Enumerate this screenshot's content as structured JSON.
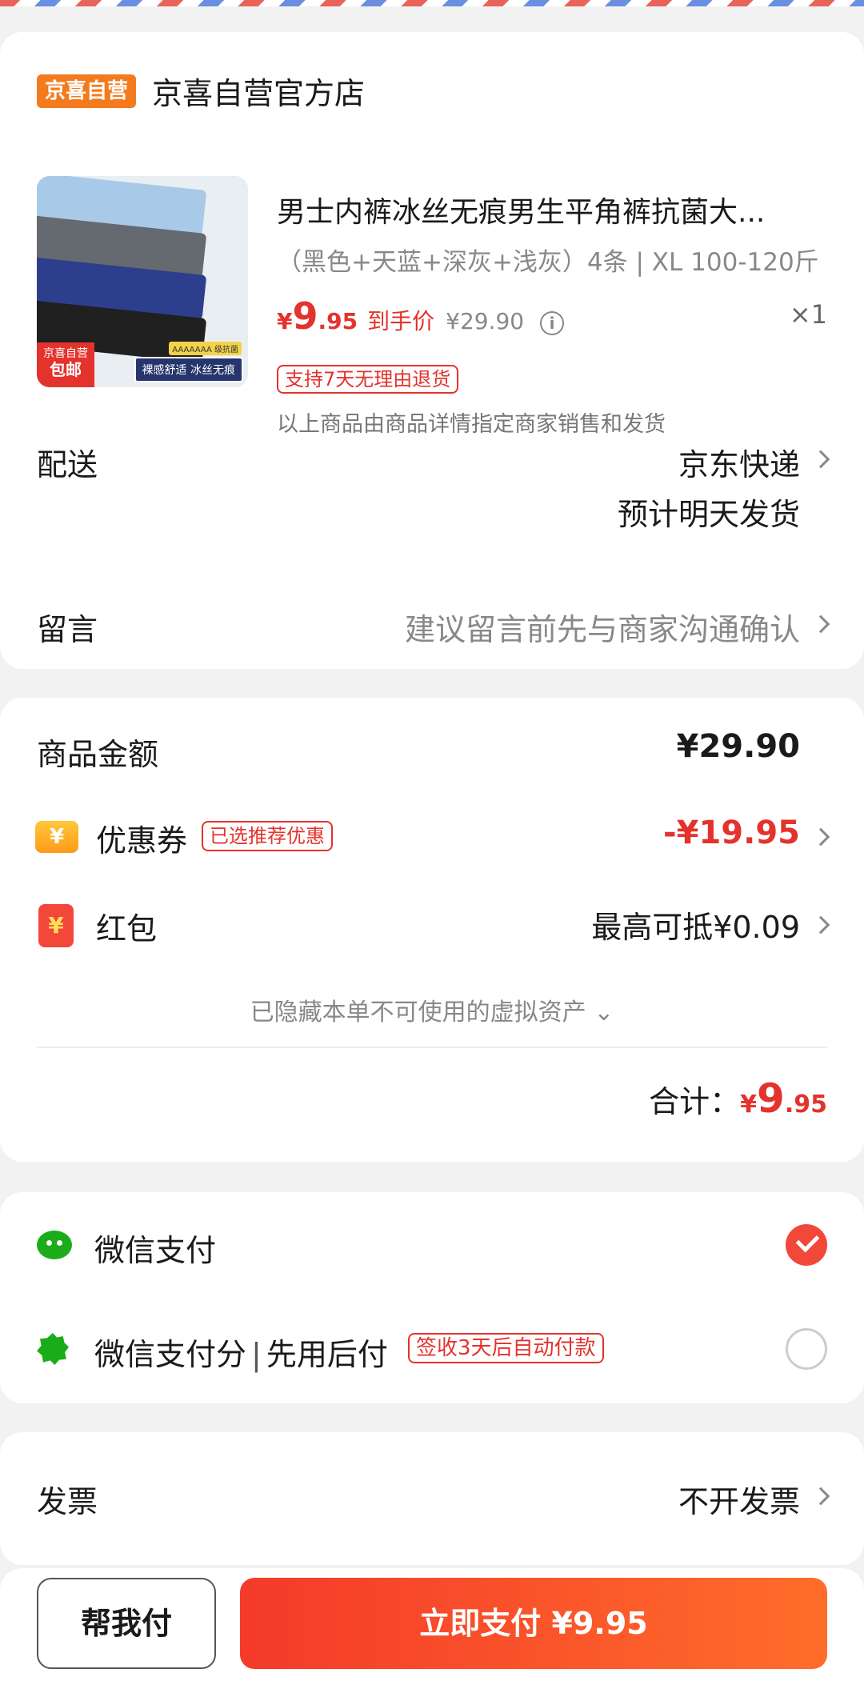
{
  "shop": {
    "badge": "京喜自营",
    "name": "京喜自营官方店"
  },
  "product": {
    "title": "男士内裤冰丝无痕男生平角裤抗菌大...",
    "spec": "（黑色+天蓝+深灰+浅灰）4条 | XL 100-120斤",
    "price_symbol": "¥",
    "price_int": "9",
    "price_dec": ".95",
    "price_label": "到手价",
    "orig_price": "¥29.90",
    "qty": "×1",
    "return_tag": "支持7天无理由退货",
    "seller_note": "以上商品由商品详情指定商家销售和发货",
    "thumb": {
      "promo_line1": "京喜自营",
      "promo_line2": "包邮",
      "feature": "裸感舒适 冰丝无痕",
      "grade": "AAAAAAA 级抗菌"
    }
  },
  "delivery": {
    "label": "配送",
    "method": "京东快递",
    "eta": "预计明天发货"
  },
  "message": {
    "label": "留言",
    "placeholder": "建议留言前先与商家沟通确认"
  },
  "amount": {
    "goods_label": "商品金额",
    "goods_value": "¥29.90",
    "coupon_label": "优惠券",
    "coupon_icon": "¥",
    "coupon_tag": "已选推荐优惠",
    "coupon_value": "-¥19.95",
    "redpack_label": "红包",
    "redpack_icon": "¥",
    "redpack_value": "最高可抵¥0.09",
    "hidden_assets": "已隐藏本单不可使用的虚拟资产 ⌄",
    "total_label": "合计：",
    "total_symbol": "¥",
    "total_int": "9",
    "total_dec": ".95"
  },
  "payment": {
    "wechat_label": "微信支付",
    "wechat_selected": true,
    "score_label_a": "微信支付分",
    "score_sep": "|",
    "score_label_b": "先用后付",
    "score_tag": "签收3天后自动付款",
    "score_selected": false
  },
  "invoice": {
    "label": "发票",
    "value": "不开发票"
  },
  "bottom": {
    "help_label": "帮我付",
    "pay_label": "立即支付 ¥9.95"
  },
  "colors": {
    "accent_red": "#e4322c",
    "shop_badge": "#f37b1d",
    "wechat_green": "#1aad19"
  }
}
